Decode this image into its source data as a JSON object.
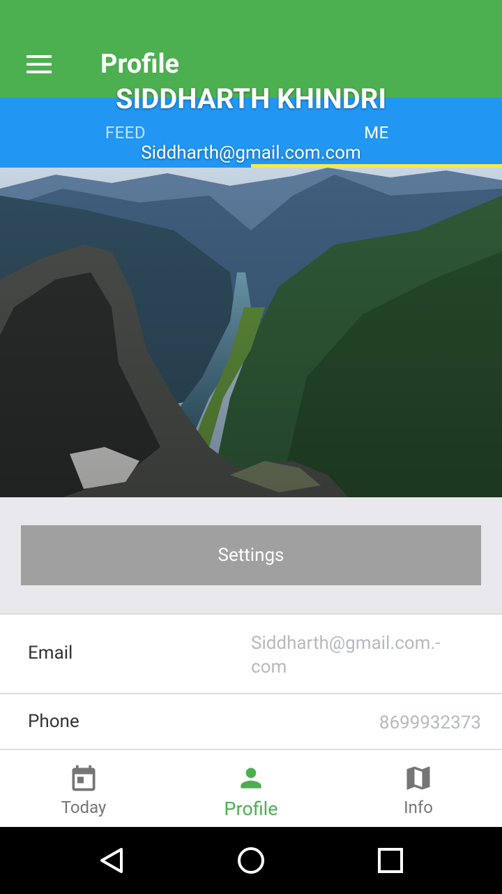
{
  "app_bar": {
    "title": "Profile",
    "menu_icon": "menu-icon",
    "background": "#4CAF50"
  },
  "tabs": {
    "background": "#2196F3",
    "indicator_color": "#FFEB3B",
    "items": [
      {
        "label": "FEED",
        "active": false
      },
      {
        "label": "ME",
        "active": true
      }
    ]
  },
  "profile": {
    "name": "SIDDHARTH KHINDRI",
    "email": "Siddharth@gmail.com.com"
  },
  "settings": {
    "label": "Settings"
  },
  "details": [
    {
      "label": "Email",
      "value": "Siddharth@gmail.com.-com"
    },
    {
      "label": "Phone",
      "value": "8699932373"
    }
  ],
  "bottom_nav": {
    "active_color": "#4CAF50",
    "items": [
      {
        "label": "Today",
        "icon": "calendar-icon",
        "active": false
      },
      {
        "label": "Profile",
        "icon": "person-icon",
        "active": true
      },
      {
        "label": "Info",
        "icon": "map-icon",
        "active": false
      }
    ]
  },
  "system_nav": {
    "icons": [
      "back-icon",
      "home-icon",
      "recents-icon"
    ]
  }
}
